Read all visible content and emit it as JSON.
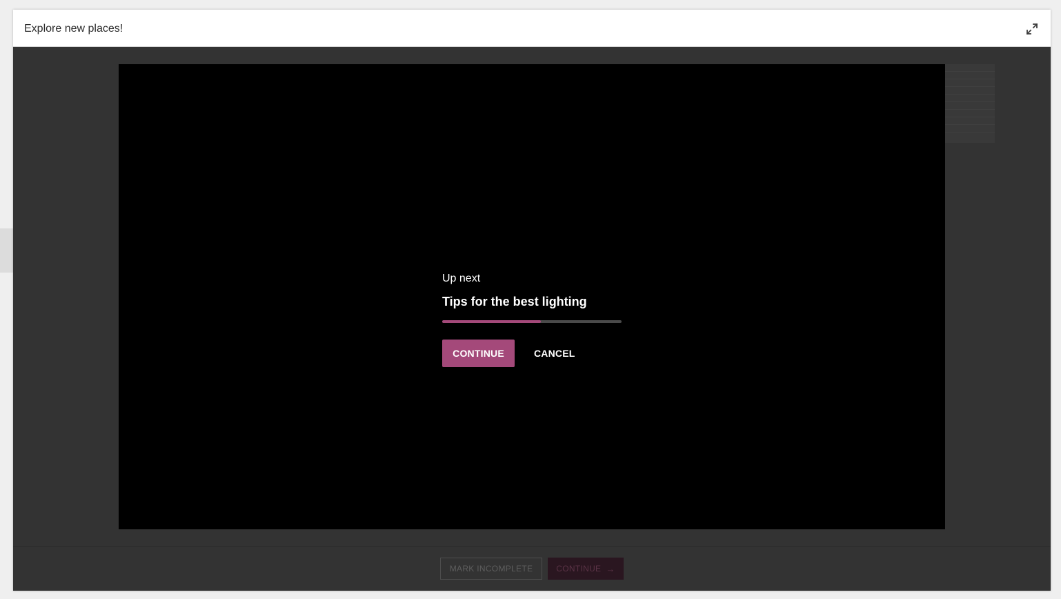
{
  "window": {
    "title": "Explore new places!",
    "expand_icon": "expand-icon"
  },
  "up_next": {
    "label": "Up next",
    "title": "Tips for the best lighting",
    "countdown_progress_percent": 55,
    "continue_label": "CONTINUE",
    "cancel_label": "CANCEL"
  },
  "footer": {
    "mark_incomplete_label": "MARK INCOMPLETE",
    "continue_label": "CONTINUE",
    "continue_icon": "arrow-right-icon"
  },
  "colors": {
    "accent": "#a4497a",
    "overlay": "#333333",
    "player": "#000000"
  }
}
